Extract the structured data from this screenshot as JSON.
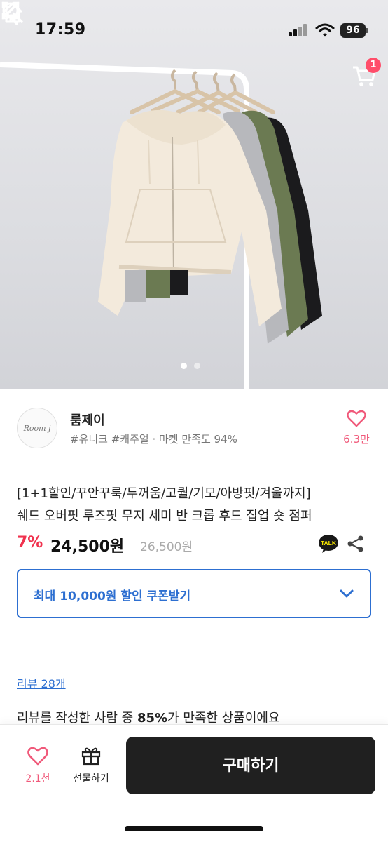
{
  "status_bar": {
    "time": "17:59",
    "battery": "96"
  },
  "nav": {
    "cart_badge": "1"
  },
  "gallery": {
    "total_slides": 2,
    "active_slide": 1
  },
  "shop": {
    "logo_text": "Room j",
    "name": "룸제이",
    "tags": "#유니크 #캐주얼 · 마켓 만족도 94%",
    "like_count": "6.3만"
  },
  "product": {
    "title_line1": "[1+1할인/꾸안꾸룩/두꺼움/고퀄/기모/아방핏/겨울까지]",
    "title_line2": "쉐드 오버핏 루즈핏 무지 세미 반 크롭 후드 집업 숏 점퍼",
    "discount": "7%",
    "price": "24,500원",
    "original_price": "26,500원",
    "talk_label": "TALK"
  },
  "coupon": {
    "label": "최대 10,000원 할인 쿠폰받기"
  },
  "reviews": {
    "link": "리뷰 28개",
    "summary_prefix": "리뷰를 작성한 사람 중 ",
    "summary_percent": "85%",
    "summary_suffix": "가 만족한 상품이에요"
  },
  "bottom_bar": {
    "like_count": "2.1천",
    "gift_label": "선물하기",
    "buy_label": "구매하기"
  },
  "colors": {
    "accent_blue": "#2d6fd1",
    "discount_red": "#f0324e",
    "like_pink": "#f0597a",
    "buy_button": "#202020"
  }
}
